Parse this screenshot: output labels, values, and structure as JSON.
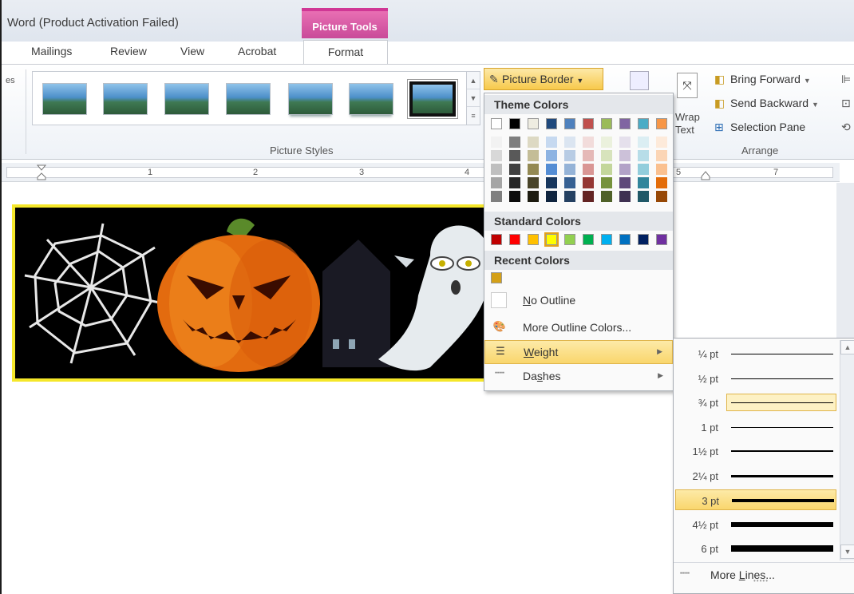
{
  "title_bar": {
    "doc_title": "Word (Product Activation Failed)",
    "contextual_tab": "Picture Tools"
  },
  "tabs": [
    "Mailings",
    "Review",
    "View",
    "Acrobat",
    "Format"
  ],
  "ribbon": {
    "cut_label": "es",
    "picture_styles_label": "Picture Styles",
    "picture_border_label": "Picture Border",
    "picture_border_icon": "pencil-icon",
    "wrap_text_label_1": "Wrap",
    "wrap_text_label_2": "Text",
    "arrange": {
      "bring_forward": "Bring Forward",
      "send_backward": "Send Backward",
      "selection_pane": "Selection Pane",
      "group_label": "Arrange"
    }
  },
  "ruler": {
    "numbers": [
      "1",
      "2",
      "3",
      "4",
      "5",
      "7"
    ]
  },
  "picture_border_menu": {
    "theme_colors_label": "Theme Colors",
    "theme_top_row": [
      "#ffffff",
      "#000000",
      "#eeece1",
      "#1f497d",
      "#4f81bd",
      "#c0504d",
      "#9bbb59",
      "#8064a2",
      "#4bacc6",
      "#f79646"
    ],
    "theme_shades": [
      [
        "#f2f2f2",
        "#d8d8d8",
        "#bfbfbf",
        "#a5a5a5",
        "#7f7f7f"
      ],
      [
        "#7f7f7f",
        "#595959",
        "#3f3f3f",
        "#262626",
        "#0c0c0c"
      ],
      [
        "#ddd9c3",
        "#c4bd97",
        "#938953",
        "#494429",
        "#1d1b10"
      ],
      [
        "#c6d9f0",
        "#8db3e2",
        "#548dd4",
        "#17365d",
        "#0f243e"
      ],
      [
        "#dbe5f1",
        "#b8cce4",
        "#95b3d7",
        "#366092",
        "#244061"
      ],
      [
        "#f2dcdb",
        "#e5b9b7",
        "#d99694",
        "#953734",
        "#632423"
      ],
      [
        "#ebf1dd",
        "#d7e3bc",
        "#c3d69b",
        "#76923c",
        "#4f6128"
      ],
      [
        "#e5e0ec",
        "#ccc1d9",
        "#b2a2c7",
        "#5f497a",
        "#3f3151"
      ],
      [
        "#dbeef3",
        "#b7dde8",
        "#92cddc",
        "#31859b",
        "#205867"
      ],
      [
        "#fdeada",
        "#fbd5b5",
        "#fac08f",
        "#e36c09",
        "#974806"
      ]
    ],
    "standard_colors_label": "Standard Colors",
    "standard_colors": [
      "#c00000",
      "#ff0000",
      "#ffc000",
      "#ffff00",
      "#92d050",
      "#00b050",
      "#00b0f0",
      "#0070c0",
      "#002060",
      "#7030a0"
    ],
    "recent_colors_label": "Recent Colors",
    "recent_colors": [
      "#d4a017"
    ],
    "no_outline": "No Outline",
    "more_outline_colors": "More Outline Colors...",
    "weight": "Weight",
    "dashes": "Dashes"
  },
  "weight_submenu": {
    "items": [
      {
        "label": "¼ pt",
        "weight": 0.25
      },
      {
        "label": "½ pt",
        "weight": 0.5
      },
      {
        "label": "¾ pt",
        "weight": 0.75
      },
      {
        "label": "1 pt",
        "weight": 1
      },
      {
        "label": "1½ pt",
        "weight": 1.5
      },
      {
        "label": "2¼ pt",
        "weight": 2.25
      },
      {
        "label": "3 pt",
        "weight": 3
      },
      {
        "label": "4½ pt",
        "weight": 4.5
      },
      {
        "label": "6 pt",
        "weight": 6
      }
    ],
    "more_lines": "More Lines..."
  }
}
